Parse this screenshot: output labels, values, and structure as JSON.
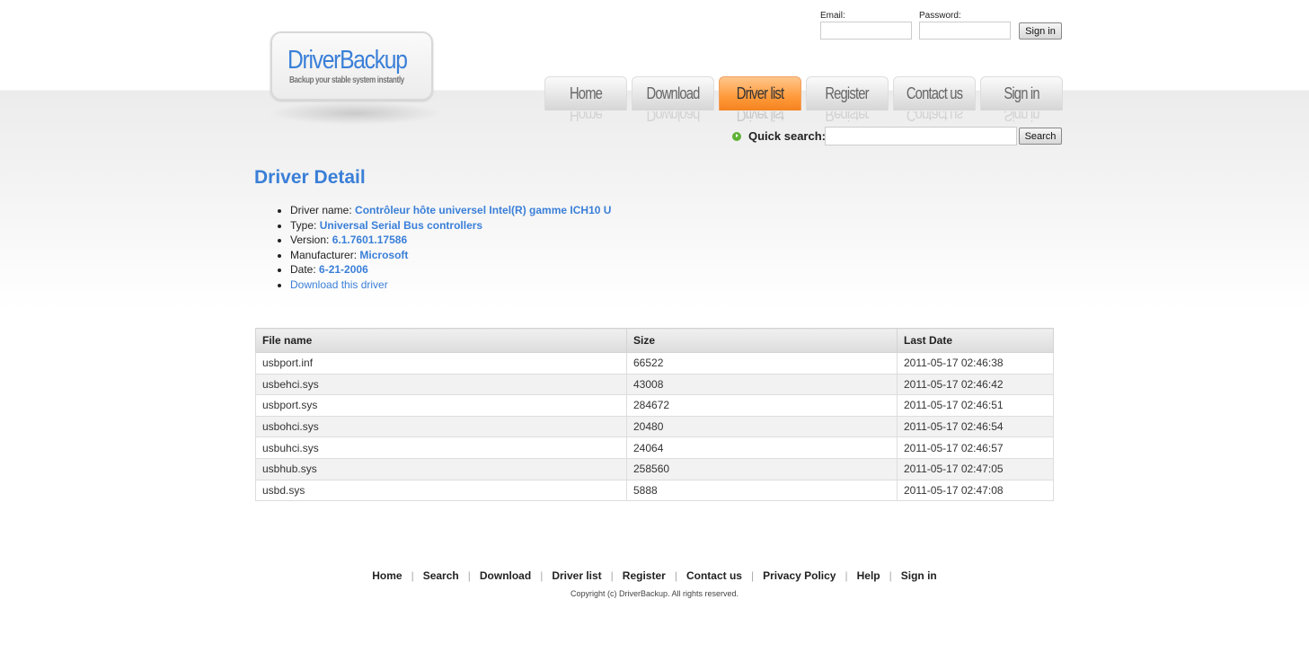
{
  "login": {
    "email_label": "Email:",
    "password_label": "Password:",
    "email_value": "",
    "password_value": "",
    "signin": "Sign in"
  },
  "logo": {
    "title": "DriverBackup",
    "tagline": "Backup your stable system instantly"
  },
  "nav": [
    {
      "label": "Home"
    },
    {
      "label": "Download"
    },
    {
      "label": "Driver list",
      "active": true
    },
    {
      "label": "Register"
    },
    {
      "label": "Contact us"
    },
    {
      "label": "Sign in"
    }
  ],
  "search": {
    "label": "Quick search:",
    "value": "",
    "button": "Search"
  },
  "detail": {
    "title": "Driver Detail",
    "name_label": "Driver name:",
    "name": "Contrôleur hôte universel Intel(R) gamme ICH10 U",
    "type_label": "Type:",
    "type": "Universal Serial Bus controllers",
    "version_label": "Version:",
    "version": "6.1.7601.17586",
    "manufacturer_label": "Manufacturer:",
    "manufacturer": "Microsoft",
    "date_label": "Date:",
    "date": "6-21-2006",
    "download": "Download this driver"
  },
  "table": {
    "headers": [
      "File name",
      "Size",
      "Last Date"
    ],
    "rows": [
      [
        "usbport.inf",
        "66522",
        "2011-05-17 02:46:38"
      ],
      [
        "usbehci.sys",
        "43008",
        "2011-05-17 02:46:42"
      ],
      [
        "usbport.sys",
        "284672",
        "2011-05-17 02:46:51"
      ],
      [
        "usbohci.sys",
        "20480",
        "2011-05-17 02:46:54"
      ],
      [
        "usbuhci.sys",
        "24064",
        "2011-05-17 02:46:57"
      ],
      [
        "usbhub.sys",
        "258560",
        "2011-05-17 02:47:05"
      ],
      [
        "usbd.sys",
        "5888",
        "2011-05-17 02:47:08"
      ]
    ]
  },
  "footer": {
    "links": [
      "Home",
      "Search",
      "Download",
      "Driver list",
      "Register",
      "Contact us",
      "Privacy Policy",
      "Help",
      "Sign in"
    ],
    "copyright": "Copyright (c) DriverBackup. All rights reserved."
  }
}
